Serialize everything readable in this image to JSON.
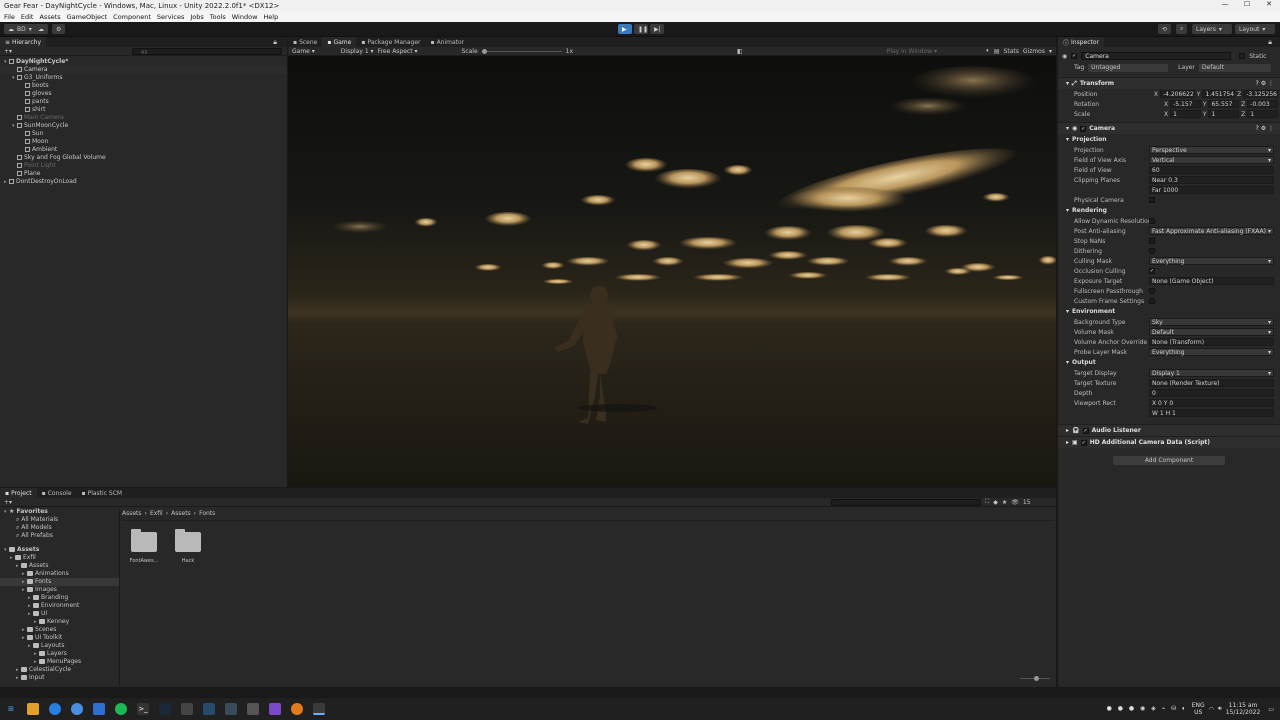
{
  "window": {
    "title": "Gear Fear - DayNightCycle - Windows, Mac, Linux - Unity 2022.2.0f1* <DX12>"
  },
  "menu": [
    "File",
    "Edit",
    "Assets",
    "GameObject",
    "Component",
    "Services",
    "Jobs",
    "Tools",
    "Window",
    "Help"
  ],
  "toolbar": {
    "account": "BD",
    "layers": "Layers",
    "layout": "Layout"
  },
  "hierarchy": {
    "tab": "Hierarchy",
    "search_placeholder": "All",
    "items": [
      {
        "label": "DayNightCycle*",
        "indent": 0,
        "bold": true
      },
      {
        "label": "Camera",
        "indent": 1,
        "selected": true
      },
      {
        "label": "G3_Uniforms",
        "indent": 1
      },
      {
        "label": "boots",
        "indent": 2
      },
      {
        "label": "gloves",
        "indent": 2
      },
      {
        "label": "pants",
        "indent": 2
      },
      {
        "label": "shirt",
        "indent": 2
      },
      {
        "label": "Main Camera",
        "indent": 1,
        "dim": true
      },
      {
        "label": "SunMoonCycle",
        "indent": 1
      },
      {
        "label": "Sun",
        "indent": 2
      },
      {
        "label": "Moon",
        "indent": 2
      },
      {
        "label": "Ambient",
        "indent": 2
      },
      {
        "label": "Sky and Fog Global Volume",
        "indent": 1
      },
      {
        "label": "Point Light",
        "indent": 1,
        "dim": true
      },
      {
        "label": "Plane",
        "indent": 1
      },
      {
        "label": "DontDestroyOnLoad",
        "indent": 0
      }
    ]
  },
  "center_tabs": [
    "Scene",
    "Game",
    "Package Manager",
    "Animator"
  ],
  "game_bar": {
    "mode": "Game",
    "display": "Display 1",
    "aspect": "Free Aspect",
    "scale_label": "Scale",
    "scale_value": "1x",
    "play_in": "Play in Window",
    "stats": "Stats",
    "gizmos": "Gizmos"
  },
  "inspector": {
    "tab": "Inspector",
    "object_name": "Camera",
    "static": "Static",
    "tag_label": "Tag",
    "tag": "Untagged",
    "layer_label": "Layer",
    "layer": "Default",
    "transform": {
      "title": "Transform",
      "rows": [
        {
          "label": "Position",
          "x": "-4.206622",
          "y": "1.451754",
          "z": "-3.125256"
        },
        {
          "label": "Rotation",
          "x": "-5.157",
          "y": "65.557",
          "z": "-0.003"
        },
        {
          "label": "Scale",
          "x": "1",
          "y": "1",
          "z": "1"
        }
      ]
    },
    "camera_title": "Camera",
    "projection_header": "Projection",
    "projection": [
      {
        "label": "Projection",
        "value": "Perspective"
      },
      {
        "label": "Field of View Axis",
        "value": "Vertical"
      },
      {
        "label": "Field of View",
        "value": "60"
      },
      {
        "label": "Clipping Planes",
        "value": "Near   0.3"
      },
      {
        "label": "",
        "value": "Far    1000"
      },
      {
        "label": "Physical Camera",
        "value": ""
      }
    ],
    "rendering_header": "Rendering",
    "rendering": [
      {
        "label": "Allow Dynamic Resolution",
        "value": ""
      },
      {
        "label": "Post Anti-aliasing",
        "value": "Fast Approximate Anti-aliasing (FXAA)"
      },
      {
        "label": "Stop NaNs",
        "value": ""
      },
      {
        "label": "Dithering",
        "value": ""
      },
      {
        "label": "Culling Mask",
        "value": "Everything"
      },
      {
        "label": "Occlusion Culling",
        "value": "✓"
      },
      {
        "label": "Exposure Target",
        "value": "None (Game Object)"
      },
      {
        "label": "Fullscreen Passthrough",
        "value": ""
      },
      {
        "label": "Custom Frame Settings",
        "value": ""
      }
    ],
    "environment_header": "Environment",
    "environment": [
      {
        "label": "Background Type",
        "value": "Sky"
      },
      {
        "label": "Volume Mask",
        "value": "Default"
      },
      {
        "label": "Volume Anchor Override",
        "value": "None (Transform)"
      },
      {
        "label": "Probe Layer Mask",
        "value": "Everything"
      }
    ],
    "output_header": "Output",
    "output": [
      {
        "label": "Target Display",
        "value": "Display 1"
      },
      {
        "label": "Target Texture",
        "value": "None (Render Texture)"
      },
      {
        "label": "Depth",
        "value": "0"
      },
      {
        "label": "Viewport Rect",
        "value": "X 0        Y 0"
      },
      {
        "label": "",
        "value": "W 1        H 1"
      }
    ],
    "audio_listener": "Audio Listener",
    "hd_camera": "HD Additional Camera Data (Script)",
    "add_component": "Add Component"
  },
  "bottom_tabs": [
    "Project",
    "Console",
    "Plastic SCM"
  ],
  "project": {
    "favorites_header": "Favorites",
    "favorites": [
      "All Materials",
      "All Models",
      "All Prefabs"
    ],
    "assets_header": "Assets",
    "tree": [
      {
        "label": "Exfil",
        "indent": 1
      },
      {
        "label": "Assets",
        "indent": 2
      },
      {
        "label": "Animations",
        "indent": 3
      },
      {
        "label": "Fonts",
        "indent": 3,
        "selected": true
      },
      {
        "label": "Images",
        "indent": 3
      },
      {
        "label": "Branding",
        "indent": 4
      },
      {
        "label": "Environment",
        "indent": 4
      },
      {
        "label": "UI",
        "indent": 4
      },
      {
        "label": "Kenney",
        "indent": 5
      },
      {
        "label": "Scenes",
        "indent": 3
      },
      {
        "label": "UI Toolkit",
        "indent": 3
      },
      {
        "label": "Layouts",
        "indent": 4
      },
      {
        "label": "Layers",
        "indent": 5
      },
      {
        "label": "MenuPages",
        "indent": 5
      },
      {
        "label": "CelestialCycle",
        "indent": 2
      },
      {
        "label": "Input",
        "indent": 2
      }
    ],
    "breadcrumb": [
      "Assets",
      "Exfil",
      "Assets",
      "Fonts"
    ],
    "folders": [
      "FontAwes...",
      "Hack"
    ],
    "item_count": "15"
  },
  "taskbar": {
    "lang": "ENG",
    "region": "US",
    "time": "11:15 am",
    "date": "15/12/2022"
  }
}
